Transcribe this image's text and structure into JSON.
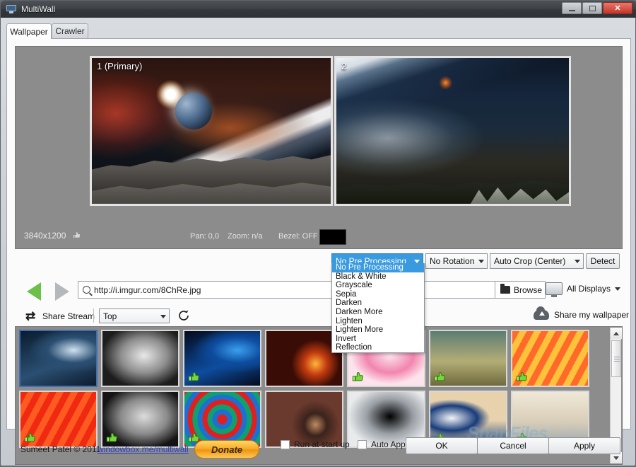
{
  "window": {
    "title": "MultiWall",
    "icon": "monitor-icon",
    "buttons": {
      "minimize": "–",
      "maximize": "□",
      "close": "✕"
    }
  },
  "tabs": [
    {
      "label": "Wallpaper",
      "active": true
    },
    {
      "label": "Crawler",
      "active": false
    }
  ],
  "preview": {
    "monitors": [
      {
        "label": "1 (Primary)"
      },
      {
        "label": "2"
      }
    ],
    "resolution": "3840x1200",
    "pan": "Pan: 0,0",
    "zoom": "Zoom: n/a",
    "bezel": "Bezel: OFF",
    "bezel_color": "#000000"
  },
  "processing": {
    "preprocess_selected": "No Pre Processing",
    "preprocess_options": [
      "No Pre Processing",
      "Black & White",
      "Grayscale",
      "Sepia",
      "Darken",
      "Darken More",
      "Lighten",
      "Lighten More",
      "Invert",
      "Reflection"
    ],
    "rotation_selected": "No Rotation",
    "crop_selected": "Auto Crop (Center)",
    "detect_label": "Detect"
  },
  "url_bar": {
    "value": "http://i.imgur.com/8ChRe.jpg",
    "browse_label": "Browse",
    "display_label": "All Displays"
  },
  "share": {
    "stream_label": "Share Stream",
    "stream_selected": "Top",
    "share_wallpaper_label": "Share my wallpaper"
  },
  "thumbnails": [
    {
      "name": "earth-horizon",
      "liked": false,
      "selected": true,
      "c1": "#0b1b2e",
      "c2": "#2b4f72",
      "c3": "#cfe2f0",
      "kind": "space"
    },
    {
      "name": "rorschach",
      "liked": false,
      "selected": false,
      "c1": "#e8e8e8",
      "c2": "#8d8d8d",
      "c3": "#1d1d1d",
      "kind": "mono"
    },
    {
      "name": "blue-planet",
      "liked": true,
      "selected": false,
      "c1": "#040a1c",
      "c2": "#0d4c9e",
      "c3": "#3aa0f0",
      "kind": "space"
    },
    {
      "name": "fire-dragon",
      "liked": false,
      "selected": false,
      "c1": "#3a0c06",
      "c2": "#c23a10",
      "c3": "#ffb43a",
      "kind": "fire"
    },
    {
      "name": "pink-lily",
      "liked": true,
      "selected": false,
      "c1": "#fde3ec",
      "c2": "#f285ae",
      "c3": "#9ec93a",
      "kind": "floral"
    },
    {
      "name": "stone-hall",
      "liked": true,
      "selected": false,
      "c1": "#6f6a3e",
      "c2": "#b3ad76",
      "c3": "#5c7d72",
      "kind": "arch"
    },
    {
      "name": "safari-sunset",
      "liked": true,
      "selected": false,
      "c1": "#ff6a2a",
      "c2": "#ffc23a",
      "c3": "#0d0d0d",
      "kind": "vector"
    },
    {
      "name": "red-knight",
      "liked": true,
      "selected": false,
      "c1": "#f02a10",
      "c2": "#ff5a22",
      "c3": "#101010",
      "kind": "vector"
    },
    {
      "name": "typewriter",
      "liked": true,
      "selected": false,
      "c1": "#dcdcdc",
      "c2": "#8a8a8a",
      "c3": "#141414",
      "kind": "mono"
    },
    {
      "name": "paint-swirl",
      "liked": true,
      "selected": false,
      "c1": "#e01f1f",
      "c2": "#1f6fd0",
      "c3": "#10a070",
      "kind": "swirl"
    },
    {
      "name": "mars-rig",
      "liked": false,
      "selected": false,
      "c1": "#6b3a2e",
      "c2": "#3a231c",
      "c3": "#c08a60",
      "kind": "fire"
    },
    {
      "name": "star-destroyer",
      "liked": false,
      "selected": false,
      "c1": "#000000",
      "c2": "#9aa0a6",
      "c3": "#e8eaec",
      "kind": "mono"
    },
    {
      "name": "great-wave",
      "liked": true,
      "selected": false,
      "c1": "#e8d2ae",
      "c2": "#183c7a",
      "c3": "#f2f4f6",
      "kind": "wave"
    },
    {
      "name": "taj-mahal",
      "liked": true,
      "selected": false,
      "c1": "#9aa6ae",
      "c2": "#d8cdb8",
      "c3": "#f0e8d8",
      "kind": "arch"
    }
  ],
  "footer": {
    "copyright": "Sumeet Patel © 2011",
    "link": "windowbox.me/multiwall",
    "donate_label": "Donate",
    "run_at_startup_label": "Run at start up",
    "auto_apply_label": "Auto Apply",
    "ok_label": "OK",
    "cancel_label": "Cancel",
    "apply_label": "Apply"
  },
  "watermark": "SnapFiles"
}
